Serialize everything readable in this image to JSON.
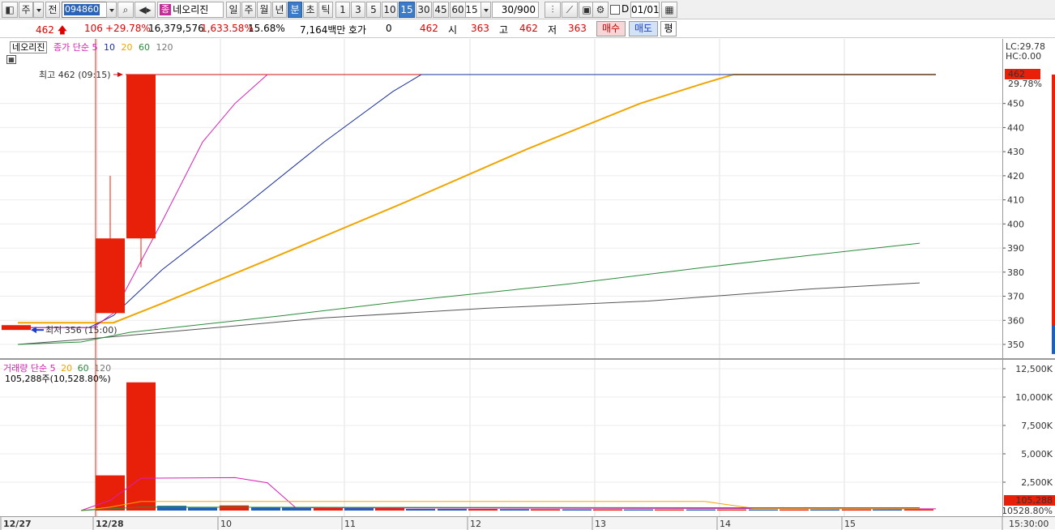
{
  "toolbar": {
    "period_primary": "주",
    "jeon_label": "전",
    "stock_code": "094860",
    "stock_badge": "종",
    "stock_name": "네오리진",
    "period_tabs": [
      "일",
      "주",
      "월",
      "년",
      "분",
      "초",
      "틱"
    ],
    "active_period": "분",
    "minute_buttons": [
      "1",
      "3",
      "5",
      "10",
      "15",
      "30",
      "45",
      "60"
    ],
    "active_minute": "15",
    "minute_select": "15",
    "count": "30/900",
    "checkbox_label": "D",
    "date": "01/01"
  },
  "quote": {
    "price": "462",
    "change": "106",
    "change_pct": "+29.78%",
    "volume": "16,379,576",
    "volume_pct": "1,633.58%",
    "turnover": "15.68%",
    "amount": "7,164백만",
    "hoga_label": "호가",
    "hoga_value": "0",
    "hoga_price": "462",
    "open_label": "시",
    "open": "363",
    "high_label": "고",
    "high": "462",
    "low_label": "저",
    "low": "363",
    "buy_label": "매수",
    "sell_label": "매도",
    "avg_label": "평"
  },
  "price_legend": {
    "name": "네오리진",
    "label": "종가 단순",
    "ma": [
      "5",
      "10",
      "20",
      "60",
      "120"
    ]
  },
  "volume_legend": {
    "label": "거래량 단순",
    "ma": [
      "5",
      "20",
      "60",
      "120"
    ],
    "info": "105,288주(10,528.80%)"
  },
  "annotations": {
    "high": "최고 462 (09:15)",
    "low": "최저 356 (15:00)"
  },
  "price_axis": {
    "lc": "LC:29.78",
    "hc": "HC:0.00",
    "current": "462",
    "current_pct": "29.78%",
    "ticks": [
      "450",
      "440",
      "430",
      "420",
      "410",
      "400",
      "390",
      "380",
      "370",
      "360",
      "350"
    ]
  },
  "volume_axis": {
    "ticks": [
      "12,500K",
      "10,000K",
      "7,500K",
      "5,000K",
      "2,500K"
    ],
    "current": "105,288",
    "current_pct": "10528.80%"
  },
  "date_axis": {
    "labels": [
      "12/27",
      "12/28",
      "10",
      "11",
      "12",
      "13",
      "14",
      "15"
    ],
    "time": "15:30:00"
  },
  "colors": {
    "up": "#e8200a",
    "down": "#1f5fb8",
    "ma5": "#d81fb5",
    "ma10": "#1a2f9a",
    "ma20": "#f0a500",
    "ma60": "#2a8a3a",
    "ma120": "#555555"
  },
  "chart_data": {
    "type": "candlestick",
    "yunit": "KRW",
    "ylim": [
      346,
      464
    ],
    "high_point": {
      "value": 462,
      "time": "09:15"
    },
    "low_point": {
      "value": 356,
      "time": "15:00"
    },
    "candles": [
      {
        "o": 358,
        "h": 358,
        "l": 356,
        "c": 356,
        "up": false
      },
      {
        "o": 363,
        "h": 420,
        "l": 363,
        "c": 394,
        "up": true
      },
      {
        "o": 394,
        "h": 462,
        "l": 382,
        "c": 462,
        "up": true
      }
    ],
    "volume_ylim": [
      0,
      12500
    ],
    "volume_unit": "K",
    "volume_last": 105288
  }
}
